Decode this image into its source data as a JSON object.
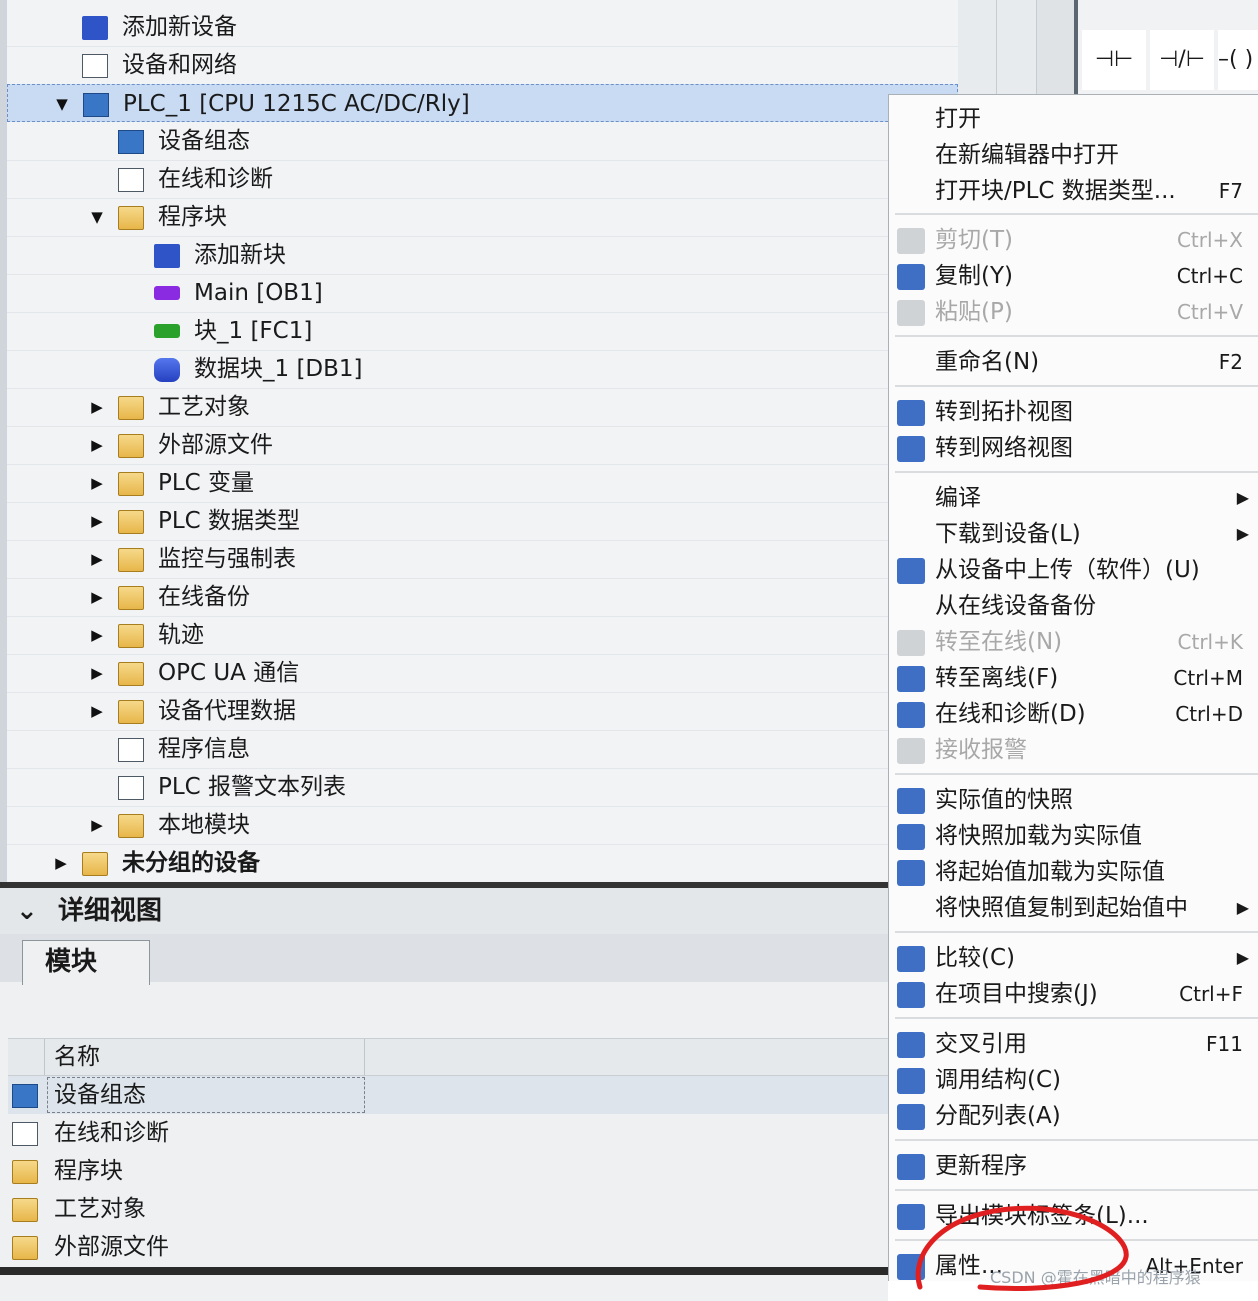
{
  "tree": {
    "items": [
      {
        "label": "添加新设备",
        "icon": "add-device-icon",
        "expander": ""
      },
      {
        "label": "设备和网络",
        "icon": "network-icon",
        "expander": ""
      },
      {
        "label": "PLC_1 [CPU 1215C AC/DC/Rly]",
        "icon": "plc-cpu-icon",
        "expander": "▼"
      },
      {
        "label": "设备组态",
        "icon": "device-config-icon",
        "expander": ""
      },
      {
        "label": "在线和诊断",
        "icon": "diagnostics-icon",
        "expander": ""
      },
      {
        "label": "程序块",
        "icon": "program-blocks-folder-icon",
        "expander": "▼"
      },
      {
        "label": "添加新块",
        "icon": "add-block-icon",
        "expander": ""
      },
      {
        "label": "Main [OB1]",
        "icon": "ob-block-icon",
        "expander": ""
      },
      {
        "label": "块_1 [FC1]",
        "icon": "fc-block-icon",
        "expander": ""
      },
      {
        "label": "数据块_1 [DB1]",
        "icon": "db-block-icon",
        "expander": ""
      },
      {
        "label": "工艺对象",
        "icon": "technology-objects-folder-icon",
        "expander": "▶"
      },
      {
        "label": "外部源文件",
        "icon": "external-source-folder-icon",
        "expander": "▶"
      },
      {
        "label": "PLC 变量",
        "icon": "plc-tags-folder-icon",
        "expander": "▶"
      },
      {
        "label": "PLC 数据类型",
        "icon": "plc-datatypes-folder-icon",
        "expander": "▶"
      },
      {
        "label": "监控与强制表",
        "icon": "watch-tables-folder-icon",
        "expander": "▶"
      },
      {
        "label": "在线备份",
        "icon": "online-backup-folder-icon",
        "expander": "▶"
      },
      {
        "label": "轨迹",
        "icon": "traces-folder-icon",
        "expander": "▶"
      },
      {
        "label": "OPC UA 通信",
        "icon": "opc-ua-folder-icon",
        "expander": "▶"
      },
      {
        "label": "设备代理数据",
        "icon": "proxy-data-folder-icon",
        "expander": "▶"
      },
      {
        "label": "程序信息",
        "icon": "program-info-icon",
        "expander": ""
      },
      {
        "label": "PLC 报警文本列表",
        "icon": "alarm-text-list-icon",
        "expander": ""
      },
      {
        "label": "本地模块",
        "icon": "local-modules-folder-icon",
        "expander": "▶"
      },
      {
        "label": "未分组的设备",
        "icon": "ungrouped-devices-icon",
        "expander": "▶"
      }
    ]
  },
  "detail": {
    "title": "详细视图",
    "collapse_glyph": "⌄",
    "tab": "模块",
    "column": "名称",
    "rows": [
      {
        "label": "设备组态",
        "icon": "device-config-icon"
      },
      {
        "label": "在线和诊断",
        "icon": "diagnostics-icon"
      },
      {
        "label": "程序块",
        "icon": "program-blocks-folder-icon"
      },
      {
        "label": "工艺对象",
        "icon": "technology-objects-folder-icon"
      },
      {
        "label": "外部源文件",
        "icon": "external-source-folder-icon"
      }
    ]
  },
  "menu": {
    "items": [
      {
        "label": "打开",
        "key": "",
        "icon": "",
        "disabled": false,
        "submenu": false
      },
      {
        "label": "在新编辑器中打开",
        "key": "",
        "icon": "",
        "disabled": false,
        "submenu": false
      },
      {
        "label": "打开块/PLC 数据类型...",
        "key": "F7",
        "icon": "",
        "disabled": false,
        "submenu": false
      },
      {
        "label": "剪切(T)",
        "key": "Ctrl+X",
        "icon": "cut-icon",
        "disabled": true,
        "submenu": false
      },
      {
        "label": "复制(Y)",
        "key": "Ctrl+C",
        "icon": "copy-icon",
        "disabled": false,
        "submenu": false
      },
      {
        "label": "粘贴(P)",
        "key": "Ctrl+V",
        "icon": "paste-icon",
        "disabled": true,
        "submenu": false
      },
      {
        "label": "重命名(N)",
        "key": "F2",
        "icon": "",
        "disabled": false,
        "submenu": false
      },
      {
        "label": "转到拓扑视图",
        "key": "",
        "icon": "topology-view-icon",
        "disabled": false,
        "submenu": false
      },
      {
        "label": "转到网络视图",
        "key": "",
        "icon": "network-view-icon",
        "disabled": false,
        "submenu": false
      },
      {
        "label": "编译",
        "key": "",
        "icon": "",
        "disabled": false,
        "submenu": true
      },
      {
        "label": "下载到设备(L)",
        "key": "",
        "icon": "",
        "disabled": false,
        "submenu": true
      },
      {
        "label": "从设备中上传（软件）(U)",
        "key": "",
        "icon": "upload-icon",
        "disabled": false,
        "submenu": false
      },
      {
        "label": "从在线设备备份",
        "key": "",
        "icon": "",
        "disabled": false,
        "submenu": false
      },
      {
        "label": "转至在线(N)",
        "key": "Ctrl+K",
        "icon": "go-online-icon",
        "disabled": true,
        "submenu": false
      },
      {
        "label": "转至离线(F)",
        "key": "Ctrl+M",
        "icon": "go-offline-icon",
        "disabled": false,
        "submenu": false
      },
      {
        "label": "在线和诊断(D)",
        "key": "Ctrl+D",
        "icon": "diagnostics-icon",
        "disabled": false,
        "submenu": false
      },
      {
        "label": "接收报警",
        "key": "",
        "icon": "receive-alarms-icon",
        "disabled": true,
        "submenu": false
      },
      {
        "label": "实际值的快照",
        "key": "",
        "icon": "snapshot-icon",
        "disabled": false,
        "submenu": false
      },
      {
        "label": "将快照加载为实际值",
        "key": "",
        "icon": "load-snapshot-icon",
        "disabled": false,
        "submenu": false
      },
      {
        "label": "将起始值加载为实际值",
        "key": "",
        "icon": "load-start-values-icon",
        "disabled": false,
        "submenu": false
      },
      {
        "label": "将快照值复制到起始值中",
        "key": "",
        "icon": "",
        "disabled": false,
        "submenu": true
      },
      {
        "label": "比较(C)",
        "key": "",
        "icon": "compare-icon",
        "disabled": false,
        "submenu": true
      },
      {
        "label": "在项目中搜索(J)",
        "key": "Ctrl+F",
        "icon": "search-in-project-icon",
        "disabled": false,
        "submenu": false
      },
      {
        "label": "交叉引用",
        "key": "F11",
        "icon": "cross-reference-icon",
        "disabled": false,
        "submenu": false
      },
      {
        "label": "调用结构(C)",
        "key": "",
        "icon": "call-structure-icon",
        "disabled": false,
        "submenu": false
      },
      {
        "label": "分配列表(A)",
        "key": "",
        "icon": "assignment-list-icon",
        "disabled": false,
        "submenu": false
      },
      {
        "label": "更新程序",
        "key": "",
        "icon": "update-program-icon",
        "disabled": false,
        "submenu": false
      },
      {
        "label": "导出模块标签条(L)...",
        "key": "",
        "icon": "export-labels-icon",
        "disabled": false,
        "submenu": false
      },
      {
        "label": "属性...",
        "key": "Alt+Enter",
        "icon": "properties-icon",
        "disabled": false,
        "submenu": false
      }
    ],
    "arrow_glyph": "▶"
  },
  "ladder": {
    "contact_no": "⊣⊢",
    "contact_nc": "⊣/⊢",
    "coil": "–( )"
  },
  "watermark": "CSDN @霍在黑暗中的程序猿",
  "colors": {
    "selection": "#c8dbf3",
    "annotation": "#e02020"
  }
}
